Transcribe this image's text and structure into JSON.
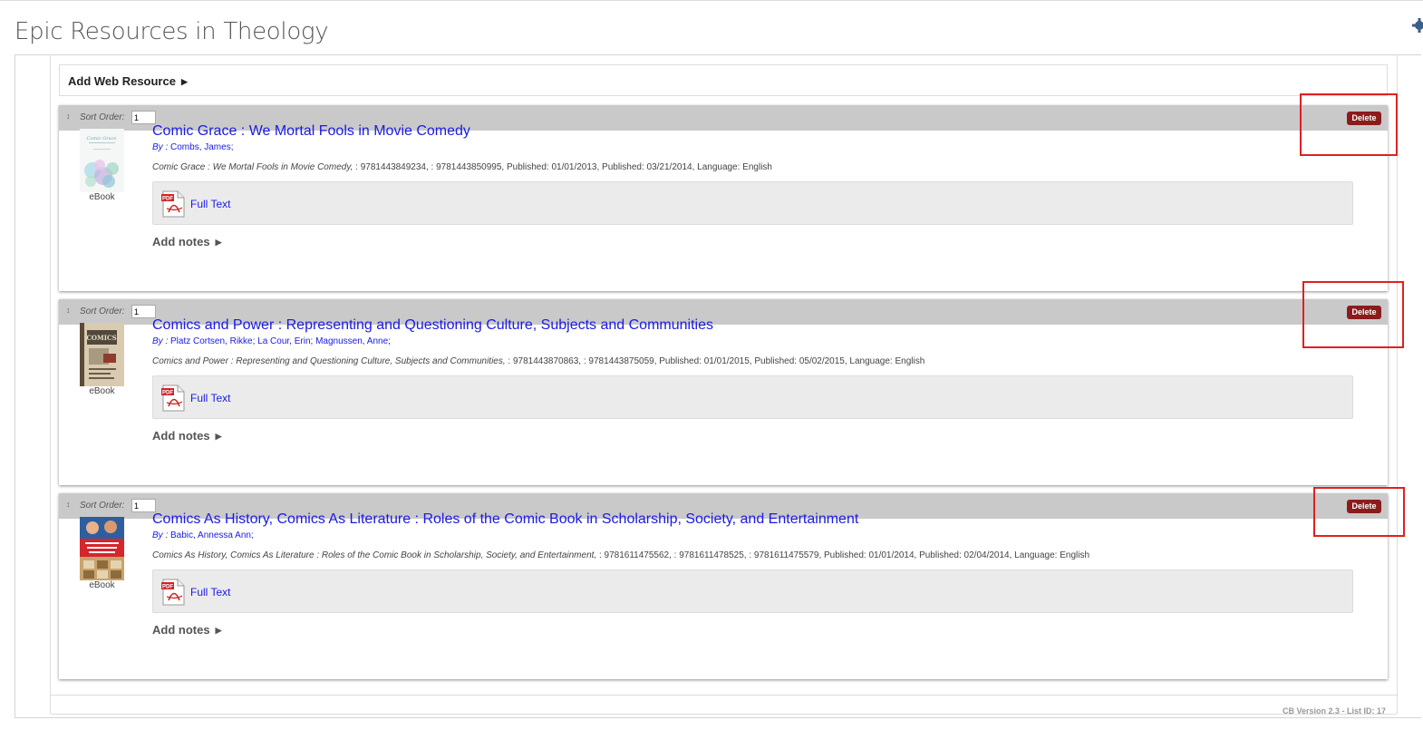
{
  "page": {
    "title": "Epic Resources in Theology",
    "add_web_resource_label": "Add Web Resource",
    "footer_version": "CB Version 2.3 - List ID: 17"
  },
  "labels": {
    "sort_order": "Sort Order:",
    "delete": "Delete",
    "full_text": "Full Text",
    "add_notes": "Add notes",
    "by": "By :"
  },
  "colors": {
    "link": "#1a1ae6",
    "delete_bg": "#8b1c1c",
    "highlight_box": "#e02020",
    "card_header": "#c9c9c9"
  },
  "items": [
    {
      "sort_order": "1",
      "type": "eBook",
      "title": "Comic Grace : We Mortal Fools in Movie Comedy",
      "authors": "Combs, James;",
      "meta_title": "Comic Grace : We Mortal Fools in Movie Comedy,",
      "meta_rest": " : 9781443849234, : 9781443850995, Published: 01/01/2013, Published: 03/21/2014, Language: English"
    },
    {
      "sort_order": "1",
      "type": "eBook",
      "title": "Comics and Power : Representing and Questioning Culture, Subjects and Communities",
      "authors": "Platz Cortsen, Rikke; La Cour, Erin; Magnussen, Anne;",
      "meta_title": "Comics and Power : Representing and Questioning Culture, Subjects and Communities,",
      "meta_rest": " : 9781443870863, : 9781443875059, Published: 01/01/2015, Published: 05/02/2015, Language: English"
    },
    {
      "sort_order": "1",
      "type": "eBook",
      "title": "Comics As History, Comics As Literature : Roles of the Comic Book in Scholarship, Society, and Entertainment",
      "authors": "Babic, Annessa Ann;",
      "meta_title": "Comics As History, Comics As Literature : Roles of the Comic Book in Scholarship, Society, and Entertainment,",
      "meta_rest": " : 9781611475562, : 9781611478525, : 9781611475579, Published: 01/01/2014, Published: 02/04/2014, Language: English"
    }
  ]
}
